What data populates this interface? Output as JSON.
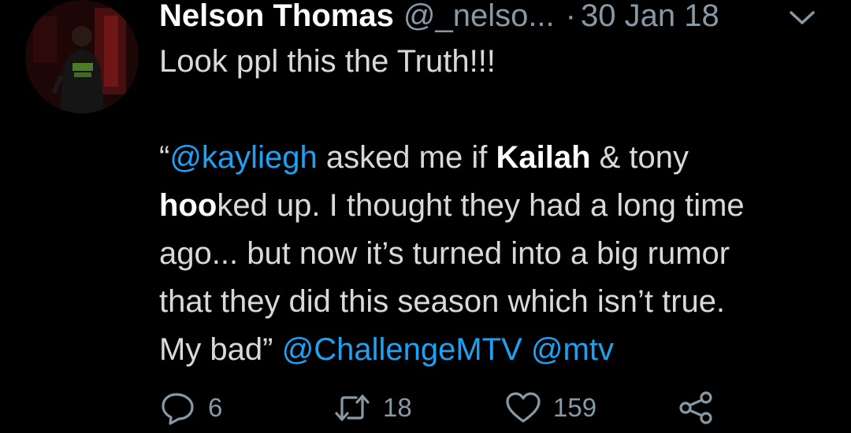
{
  "tweet": {
    "author_name": "Nelson Thomas",
    "author_handle": "@_nelso...",
    "separator": "·",
    "date": "30 Jan 18",
    "body": {
      "line1": "Look ppl this the Truth!!!",
      "quote_open": " “",
      "mention_kayliegh": "@kayliegh",
      "text_asked": " asked me if ",
      "bold_kailah": "Kailah",
      "text_amp_tony": " & tony",
      "bold_hoo": "hoo",
      "text_ked_up": "ked up. I thought they had a long time",
      "line5": "ago... but now it’s turned into a big rumor",
      "line6": "that they did this season which isn’t true.",
      "text_my_bad": "My bad” ",
      "mention_challenge": "@ChallengeMTV",
      "space": " ",
      "mention_mtv": "@mtv"
    },
    "actions": {
      "reply_count": "6",
      "retweet_count": "18",
      "like_count": "159"
    },
    "icons": {
      "reply": "reply-icon",
      "retweet": "retweet-icon",
      "like": "heart-icon",
      "share": "share-icon",
      "menu": "chevron-down-icon"
    },
    "colors": {
      "background": "#000000",
      "text": "#d9d9d9",
      "name": "#ffffff",
      "secondary": "#8899a6",
      "mention": "#1da1f2"
    }
  }
}
